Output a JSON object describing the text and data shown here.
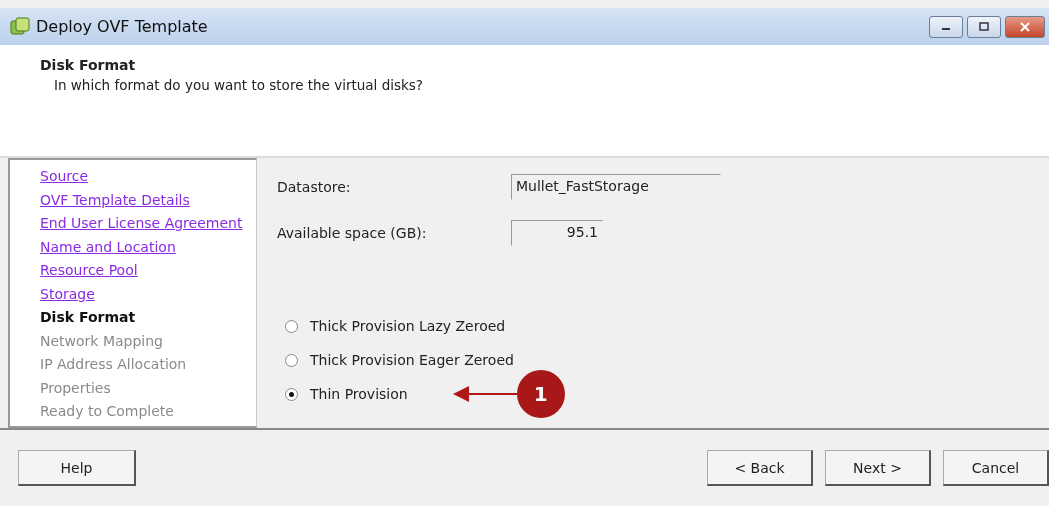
{
  "window": {
    "title": "Deploy OVF Template"
  },
  "header": {
    "title": "Disk Format",
    "subtitle": "In which format do you want to store the virtual disks?"
  },
  "steps": [
    {
      "label": "Source",
      "kind": "done"
    },
    {
      "label": "OVF Template Details",
      "kind": "done"
    },
    {
      "label": "End User License Agreement",
      "kind": "done"
    },
    {
      "label": "Name and Location",
      "kind": "done"
    },
    {
      "label": "Resource Pool",
      "kind": "done"
    },
    {
      "label": "Storage",
      "kind": "done"
    },
    {
      "label": "Disk Format",
      "kind": "current"
    },
    {
      "label": "Network Mapping",
      "kind": "pending"
    },
    {
      "label": "IP Address Allocation",
      "kind": "pending"
    },
    {
      "label": "Properties",
      "kind": "pending"
    },
    {
      "label": "Ready to Complete",
      "kind": "pending"
    }
  ],
  "fields": [
    {
      "label": "Datastore:",
      "value": "Mullet_FastStorage",
      "kind": "text"
    },
    {
      "label": "Available space (GB):",
      "value": "95.1",
      "kind": "number"
    }
  ],
  "formats": [
    {
      "label": "Thick Provision Lazy Zeroed",
      "selected": false
    },
    {
      "label": "Thick Provision Eager Zeroed",
      "selected": false
    },
    {
      "label": "Thin Provision",
      "selected": true
    }
  ],
  "callout": {
    "number": "1"
  },
  "buttons": {
    "help": "Help",
    "back": "< Back",
    "next": "Next >",
    "cancel": "Cancel"
  }
}
